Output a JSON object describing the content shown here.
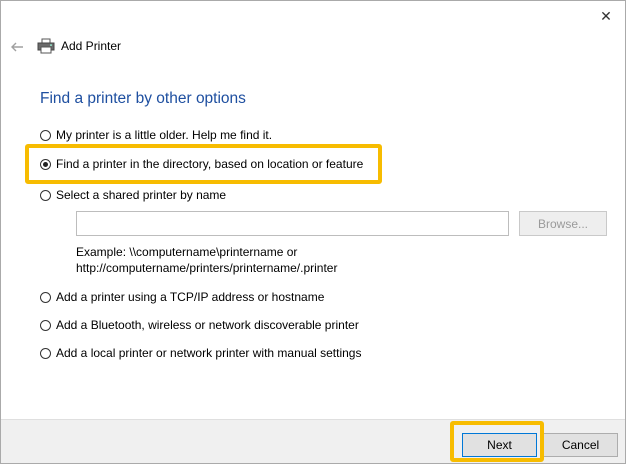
{
  "window": {
    "title": "Add Printer",
    "close_glyph": "✕",
    "back_glyph": "←"
  },
  "heading": "Find a printer by other options",
  "options": [
    {
      "label": "My printer is a little older. Help me find it.",
      "selected": false
    },
    {
      "label": "Find a printer in the directory, based on location or feature",
      "selected": true
    },
    {
      "label": "Select a shared printer by name",
      "selected": false
    },
    {
      "label": "Add a printer using a TCP/IP address or hostname",
      "selected": false
    },
    {
      "label": "Add a Bluetooth, wireless or network discoverable printer",
      "selected": false
    },
    {
      "label": "Add a local printer or network printer with manual settings",
      "selected": false
    }
  ],
  "shared_printer": {
    "input_value": "",
    "browse_label": "Browse...",
    "example_line1": "Example: \\\\computername\\printername or",
    "example_line2": "http://computername/printers/printername/.printer"
  },
  "footer": {
    "next_label": "Next",
    "cancel_label": "Cancel"
  },
  "colors": {
    "heading": "#1e4fa0",
    "highlight": "#f7bc00"
  }
}
